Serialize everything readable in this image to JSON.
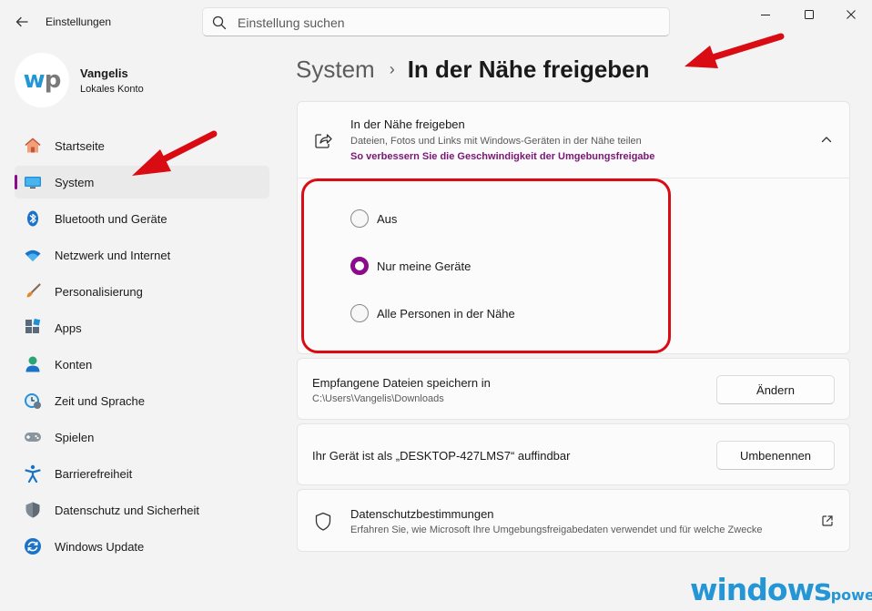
{
  "window": {
    "title": "Einstellungen",
    "minimize_icon": "minimize-icon",
    "maximize_icon": "maximize-icon",
    "close_icon": "close-icon"
  },
  "search": {
    "placeholder": "Einstellung suchen"
  },
  "profile": {
    "avatar_text_a": "w",
    "avatar_text_b": "p",
    "name": "Vangelis",
    "account_type": "Lokales Konto"
  },
  "sidebar": {
    "items": [
      {
        "label": "Startseite",
        "icon": "home-icon"
      },
      {
        "label": "System",
        "icon": "system-icon",
        "active": true
      },
      {
        "label": "Bluetooth und Geräte",
        "icon": "bluetooth-icon"
      },
      {
        "label": "Netzwerk und Internet",
        "icon": "wifi-icon"
      },
      {
        "label": "Personalisierung",
        "icon": "brush-icon"
      },
      {
        "label": "Apps",
        "icon": "apps-icon"
      },
      {
        "label": "Konten",
        "icon": "person-icon"
      },
      {
        "label": "Zeit und Sprache",
        "icon": "clock-globe-icon"
      },
      {
        "label": "Spielen",
        "icon": "gamepad-icon"
      },
      {
        "label": "Barrierefreiheit",
        "icon": "accessibility-icon"
      },
      {
        "label": "Datenschutz und Sicherheit",
        "icon": "shield-icon"
      },
      {
        "label": "Windows Update",
        "icon": "update-icon"
      }
    ]
  },
  "breadcrumb": {
    "parent": "System",
    "separator": "›",
    "current": "In der Nähe freigeben"
  },
  "nearby_share": {
    "title": "In der Nähe freigeben",
    "description": "Dateien, Fotos und Links mit Windows-Geräten in der Nähe teilen",
    "link": "So verbessern Sie die Geschwindigkeit der Umgebungsfreigabe",
    "expanded": true,
    "options": [
      {
        "label": "Aus",
        "checked": false
      },
      {
        "label": "Nur meine Geräte",
        "checked": true
      },
      {
        "label": "Alle Personen in der Nähe",
        "checked": false
      }
    ]
  },
  "save_location": {
    "title": "Empfangene Dateien speichern in",
    "path": "C:\\Users\\Vangelis\\Downloads",
    "button": "Ändern"
  },
  "discoverable": {
    "text": "Ihr Gerät ist als „DESKTOP-427LMS7“ auffindbar",
    "button": "Umbenennen"
  },
  "privacy": {
    "title": "Datenschutzbestimmungen",
    "description": "Erfahren Sie, wie Microsoft Ihre Umgebungsfreigabedaten verwendet und für welche Zwecke"
  },
  "watermark": {
    "main": "windows",
    "suffix": "power."
  },
  "colors": {
    "accent": "#8a0c8a",
    "annotation": "#d90c14",
    "brand": "#2596d5"
  }
}
